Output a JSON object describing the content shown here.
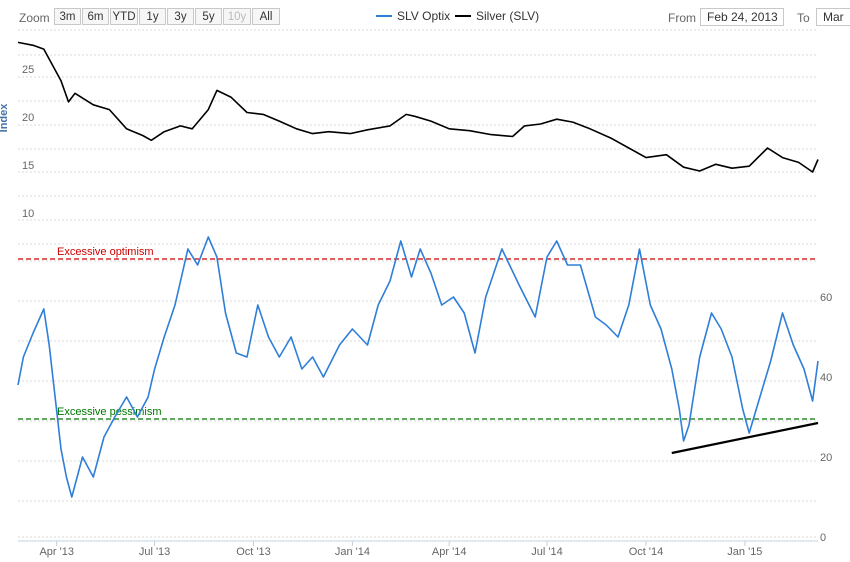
{
  "toolbar": {
    "zoom_label": "Zoom",
    "zoom_buttons": [
      "3m",
      "6m",
      "YTD",
      "1y",
      "3y",
      "5y",
      "10y",
      "All"
    ],
    "from_label": "From",
    "from_value": "Feb 24, 2013",
    "to_label": "To",
    "to_value": "Mar"
  },
  "chart_data": {
    "type": "line",
    "legend": [
      {
        "name": "SLV Optix",
        "color": "#2f7ed8"
      },
      {
        "name": "Silver (SLV)",
        "color": "#000000"
      }
    ],
    "x_tick_labels": [
      "Apr '13",
      "Jul '13",
      "Oct '13",
      "Jan '14",
      "Apr '14",
      "Jul '14",
      "Oct '14",
      "Jan '15"
    ],
    "upper_axis": {
      "label": "Index",
      "ticks": [
        "25",
        "20",
        "15",
        "10"
      ]
    },
    "lower_axis": {
      "ticks": [
        "60",
        "40",
        "20",
        "0"
      ],
      "ylim": [
        0,
        80
      ]
    },
    "series": [
      {
        "name": "Silver (SLV)",
        "color": "#000000",
        "x": [
          "2013-02-24",
          "2013-03-10",
          "2013-03-20",
          "2013-04-05",
          "2013-04-12",
          "2013-04-18",
          "2013-05-05",
          "2013-05-20",
          "2013-06-05",
          "2013-06-20",
          "2013-06-28",
          "2013-07-10",
          "2013-07-25",
          "2013-08-05",
          "2013-08-20",
          "2013-08-28",
          "2013-09-10",
          "2013-09-25",
          "2013-10-10",
          "2013-10-25",
          "2013-11-10",
          "2013-11-25",
          "2013-12-10",
          "2013-12-30",
          "2014-01-15",
          "2014-02-05",
          "2014-02-20",
          "2014-02-28",
          "2014-03-15",
          "2014-04-01",
          "2014-04-20",
          "2014-05-10",
          "2014-05-30",
          "2014-06-10",
          "2014-06-25",
          "2014-07-10",
          "2014-07-25",
          "2014-08-10",
          "2014-08-30",
          "2014-09-15",
          "2014-10-01",
          "2014-10-20",
          "2014-11-05",
          "2014-11-20",
          "2014-12-05",
          "2014-12-20",
          "2015-01-05",
          "2015-01-22",
          "2015-02-05",
          "2015-02-20",
          "2015-03-05",
          "2015-03-10"
        ],
        "values": [
          28.5,
          28.2,
          27.8,
          24.5,
          22.3,
          23.2,
          22.0,
          21.5,
          19.5,
          18.8,
          18.3,
          19.2,
          19.8,
          19.5,
          21.5,
          23.5,
          22.8,
          21.2,
          21.0,
          20.3,
          19.5,
          19.0,
          19.2,
          19.0,
          19.4,
          19.8,
          21.0,
          20.8,
          20.3,
          19.5,
          19.3,
          18.9,
          18.7,
          19.8,
          20.0,
          20.5,
          20.2,
          19.5,
          18.5,
          17.5,
          16.5,
          16.8,
          15.5,
          15.1,
          15.8,
          15.4,
          15.6,
          17.5,
          16.5,
          16.0,
          15.0,
          16.3
        ]
      },
      {
        "name": "SLV Optix",
        "color": "#2f7ed8",
        "x": [
          "2013-02-24",
          "2013-03-01",
          "2013-03-10",
          "2013-03-20",
          "2013-03-25",
          "2013-04-05",
          "2013-04-10",
          "2013-04-15",
          "2013-04-25",
          "2013-05-05",
          "2013-05-15",
          "2013-05-25",
          "2013-06-05",
          "2013-06-15",
          "2013-06-25",
          "2013-07-01",
          "2013-07-10",
          "2013-07-20",
          "2013-08-01",
          "2013-08-10",
          "2013-08-20",
          "2013-08-28",
          "2013-09-05",
          "2013-09-15",
          "2013-09-25",
          "2013-10-05",
          "2013-10-15",
          "2013-10-25",
          "2013-11-05",
          "2013-11-15",
          "2013-11-25",
          "2013-12-05",
          "2013-12-20",
          "2014-01-01",
          "2014-01-15",
          "2014-01-25",
          "2014-02-05",
          "2014-02-15",
          "2014-02-25",
          "2014-03-05",
          "2014-03-15",
          "2014-03-25",
          "2014-04-05",
          "2014-04-15",
          "2014-04-25",
          "2014-05-05",
          "2014-05-20",
          "2014-06-05",
          "2014-06-20",
          "2014-07-01",
          "2014-07-10",
          "2014-07-20",
          "2014-08-01",
          "2014-08-15",
          "2014-08-25",
          "2014-09-05",
          "2014-09-15",
          "2014-09-25",
          "2014-10-05",
          "2014-10-15",
          "2014-10-25",
          "2014-11-01",
          "2014-11-05",
          "2014-11-10",
          "2014-11-20",
          "2014-12-01",
          "2014-12-10",
          "2014-12-20",
          "2014-12-30",
          "2015-01-05",
          "2015-01-15",
          "2015-01-25",
          "2015-02-05",
          "2015-02-15",
          "2015-02-25",
          "2015-03-01",
          "2015-03-05",
          "2015-03-10"
        ],
        "values": [
          38,
          45,
          51,
          57,
          48,
          22,
          15,
          10,
          20,
          15,
          25,
          30,
          35,
          30,
          35,
          42,
          50,
          58,
          72,
          68,
          75,
          70,
          56,
          46,
          45,
          58,
          50,
          45,
          50,
          42,
          45,
          40,
          48,
          52,
          48,
          58,
          64,
          74,
          65,
          72,
          66,
          58,
          60,
          56,
          46,
          60,
          72,
          63,
          55,
          70,
          74,
          68,
          68,
          55,
          53,
          50,
          58,
          72,
          58,
          52,
          42,
          32,
          24,
          28,
          45,
          56,
          52,
          45,
          32,
          26,
          35,
          44,
          56,
          48,
          42,
          38,
          34,
          44
        ]
      }
    ],
    "annotations": [
      {
        "text": "Excessive optimism",
        "value": 69.5,
        "color": "#cc0000"
      },
      {
        "text": "Excessive pessimism",
        "value": 29.5,
        "color": "#007700"
      }
    ],
    "trendline": {
      "x": [
        "2014-10-25",
        "2015-03-10"
      ],
      "values": [
        21,
        28.5
      ],
      "color": "#000000"
    }
  }
}
